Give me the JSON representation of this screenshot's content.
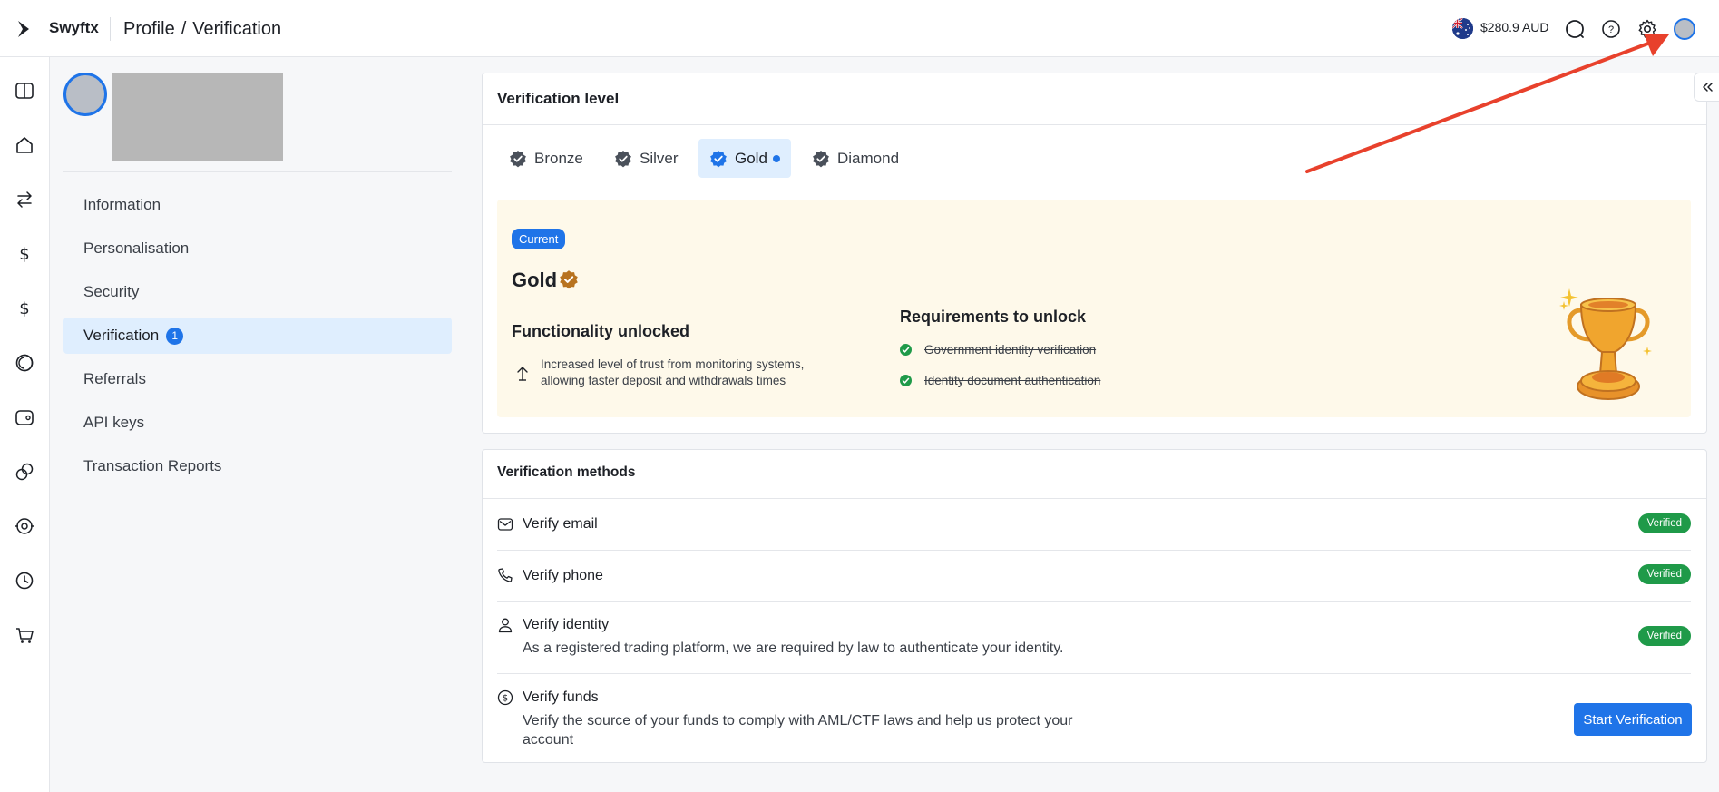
{
  "app": {
    "brand": "Swyftx"
  },
  "breadcrumb": {
    "section": "Profile",
    "separator": "/",
    "page": "Verification"
  },
  "header": {
    "balance": "$280.9 AUD"
  },
  "sidebar": {
    "items": [
      {
        "label": "Information"
      },
      {
        "label": "Personalisation"
      },
      {
        "label": "Security"
      },
      {
        "label": "Verification",
        "badge": "1"
      },
      {
        "label": "Referrals"
      },
      {
        "label": "API keys"
      },
      {
        "label": "Transaction Reports"
      }
    ]
  },
  "verification_level": {
    "title": "Verification level",
    "tiers": [
      {
        "label": "Bronze"
      },
      {
        "label": "Silver"
      },
      {
        "label": "Gold"
      },
      {
        "label": "Diamond"
      }
    ],
    "current_pill": "Current",
    "current_level": "Gold",
    "functionality_title": "Functionality unlocked",
    "functionality_text_1": "Increased level of trust from monitoring systems,",
    "functionality_text_2": "allowing faster deposit and withdrawals times",
    "requirements_title": "Requirements to unlock",
    "requirements": [
      {
        "label": "Government identity verification"
      },
      {
        "label": "Identity document authentication"
      }
    ]
  },
  "verification_methods": {
    "title": "Verification methods",
    "items": [
      {
        "label": "Verify email",
        "status": "Verified"
      },
      {
        "label": "Verify phone",
        "status": "Verified"
      },
      {
        "label": "Verify identity",
        "description": "As a registered trading platform, we are required by law to authenticate your identity.",
        "status": "Verified"
      },
      {
        "label": "Verify funds",
        "description_1": "Verify the source of your funds to comply with AML/CTF laws and help us protect your",
        "description_2": "account",
        "action": "Start Verification"
      }
    ]
  },
  "colors": {
    "accent": "#1f74e8",
    "verified": "#1f9a49",
    "gold_panel": "#fef9ea",
    "annotation_arrow": "#e8412c"
  }
}
